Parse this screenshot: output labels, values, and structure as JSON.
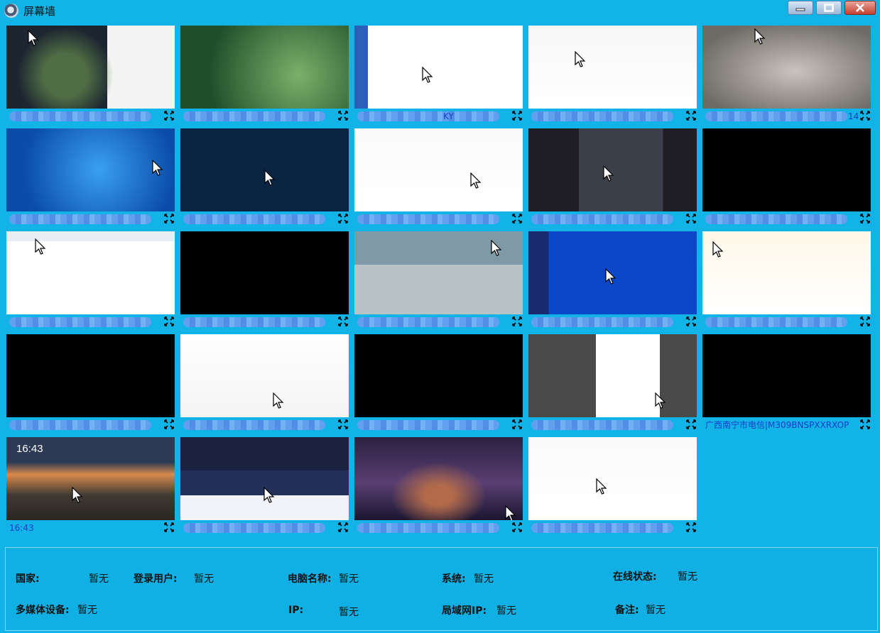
{
  "window": {
    "title": "屏幕墙"
  },
  "tiles": [
    {
      "row": 0,
      "col": 0,
      "scene": "game",
      "caption": ""
    },
    {
      "row": 0,
      "col": 1,
      "scene": "desktop-green",
      "caption": ""
    },
    {
      "row": 0,
      "col": 2,
      "scene": "doc-blue",
      "caption": "KY"
    },
    {
      "row": 0,
      "col": 3,
      "scene": "white",
      "caption": ""
    },
    {
      "row": 0,
      "col": 4,
      "scene": "photo-food",
      "caption": "14"
    },
    {
      "row": 1,
      "col": 0,
      "scene": "win7",
      "caption": ""
    },
    {
      "row": 1,
      "col": 1,
      "scene": "navy",
      "caption": ""
    },
    {
      "row": 1,
      "col": 2,
      "scene": "doc",
      "caption": ""
    },
    {
      "row": 1,
      "col": 3,
      "scene": "dark-app",
      "caption": ""
    },
    {
      "row": 1,
      "col": 4,
      "scene": "black",
      "caption": ""
    },
    {
      "row": 2,
      "col": 0,
      "scene": "table",
      "caption": ""
    },
    {
      "row": 2,
      "col": 1,
      "scene": "black",
      "caption": ""
    },
    {
      "row": 2,
      "col": 2,
      "scene": "photo-girl",
      "caption": ""
    },
    {
      "row": 2,
      "col": 3,
      "scene": "win10-blue",
      "caption": ""
    },
    {
      "row": 2,
      "col": 4,
      "scene": "sheet",
      "caption": ""
    },
    {
      "row": 3,
      "col": 0,
      "scene": "black",
      "caption": ""
    },
    {
      "row": 3,
      "col": 1,
      "scene": "spreadsheet",
      "caption": ""
    },
    {
      "row": 3,
      "col": 2,
      "scene": "black",
      "caption": ""
    },
    {
      "row": 3,
      "col": 3,
      "scene": "pdf",
      "caption": ""
    },
    {
      "row": 3,
      "col": 4,
      "scene": "black",
      "caption": "广西南宁市电信|M309BNSPXXRXOP"
    },
    {
      "row": 4,
      "col": 0,
      "scene": "lock-sunset",
      "caption": "16:43",
      "time": "16:43"
    },
    {
      "row": 4,
      "col": 1,
      "scene": "web",
      "caption": ""
    },
    {
      "row": 4,
      "col": 2,
      "scene": "night-sky",
      "caption": ""
    },
    {
      "row": 4,
      "col": 3,
      "scene": "doc",
      "caption": ""
    }
  ],
  "info": {
    "country_label": "国家:",
    "country_value": "暂无",
    "user_label": "登录用户:",
    "user_value": "暂无",
    "pc_label": "电脑名称:",
    "pc_value": "暂无",
    "os_label": "系统:",
    "os_value": "暂无",
    "online_label": "在线状态:",
    "online_value": "暂无",
    "media_label": "多媒体设备:",
    "media_value": "暂无",
    "ip_label": "IP:",
    "ip_value": "暂无",
    "lan_label": "局域网IP:",
    "lan_value": "暂无",
    "note_label": "备注:",
    "note_value": "暂无"
  }
}
